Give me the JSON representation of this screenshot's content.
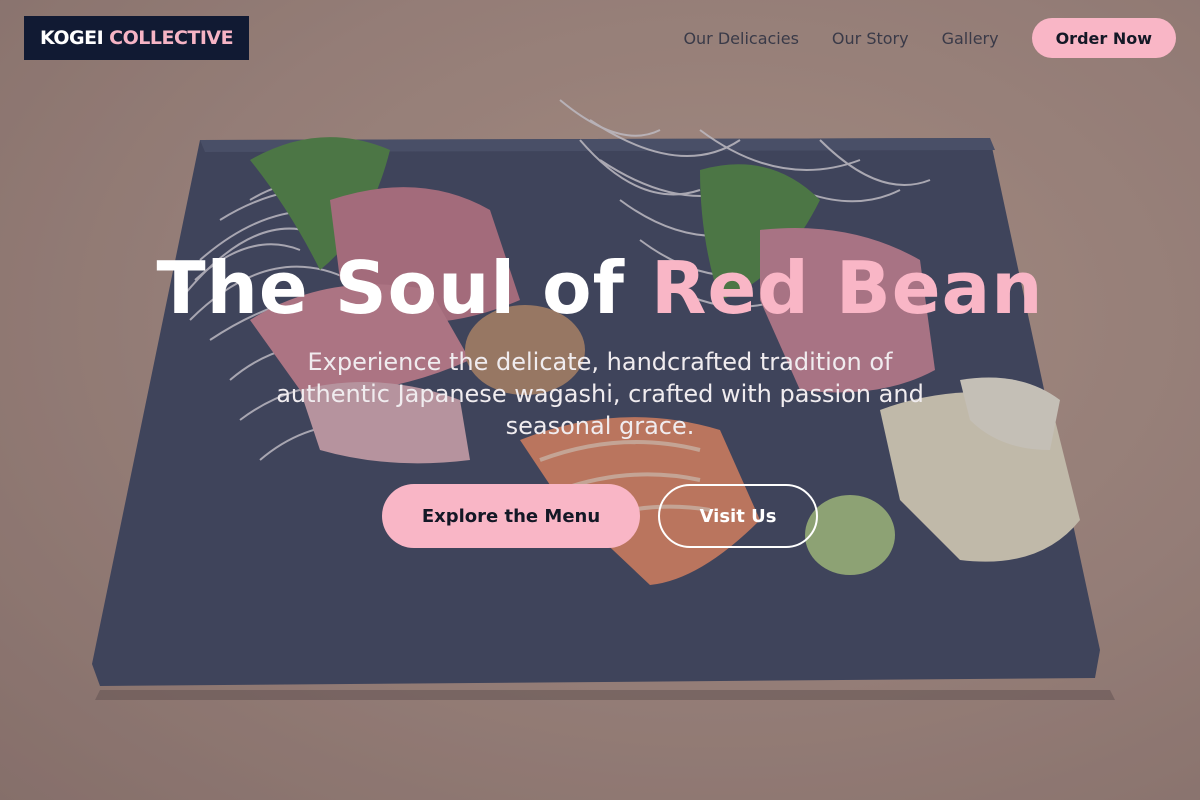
{
  "brand": {
    "name_part1": "KOGEI",
    "name_part2": "COLLECTIVE"
  },
  "nav": {
    "links": [
      "Our Delicacies",
      "Our Story",
      "Gallery"
    ],
    "cta_label": "Order Now"
  },
  "hero": {
    "title_part1": "The Soul of",
    "title_accent": "Red Bean",
    "subtitle": "Experience the delicate, handcrafted tradition of authentic Japanese wagashi, crafted with passion and seasonal grace.",
    "primary_label": "Explore the Menu",
    "secondary_label": "Visit Us"
  },
  "colors": {
    "accent_pink": "#f9b6c6",
    "logo_bg": "#111a33",
    "text_dark": "#141826"
  }
}
